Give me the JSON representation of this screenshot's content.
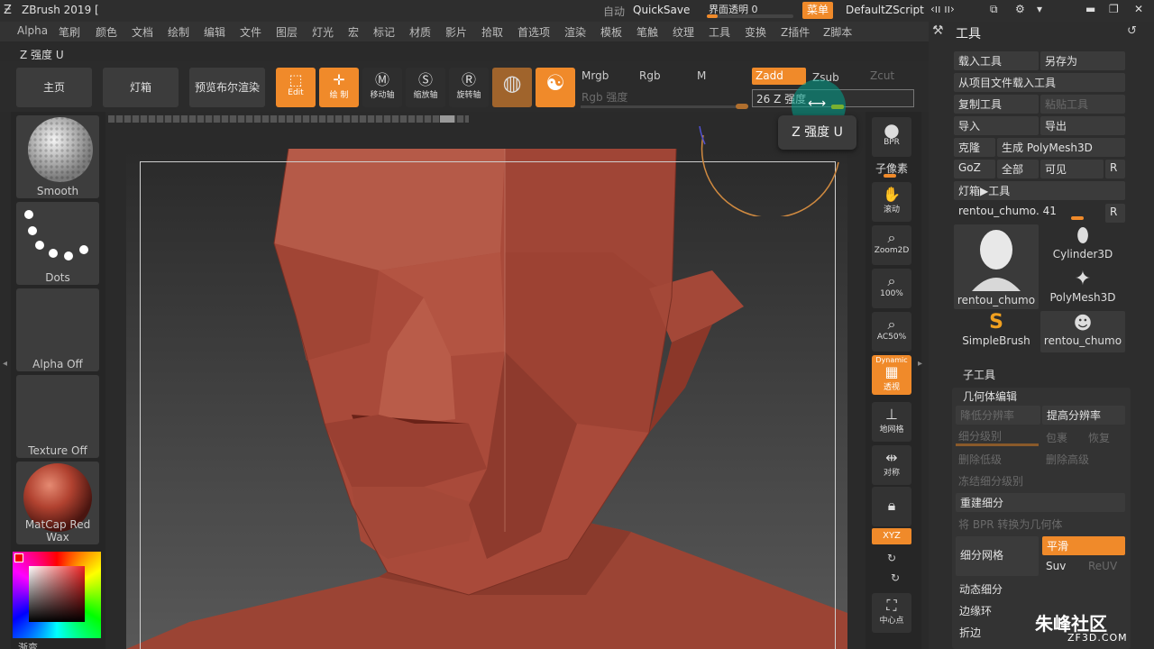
{
  "titlebar": {
    "title": "ZBrush 2019 [",
    "auto_label": "自动",
    "quicksave": "QuickSave",
    "transparency": "界面透明 0",
    "menu": "菜单",
    "script": "DefaultZScript"
  },
  "menubar": {
    "items": [
      "Alpha",
      "笔刷",
      "颜色",
      "文档",
      "绘制",
      "编辑",
      "文件",
      "图层",
      "灯光",
      "宏",
      "标记",
      "材质",
      "影片",
      "拾取",
      "首选项",
      "渲染",
      "模板",
      "笔触",
      "纹理",
      "工具",
      "变换",
      "Z插件",
      "Z脚本"
    ]
  },
  "breadcrumb": {
    "title": "Z 强度  U"
  },
  "shelf": {
    "home": "主页",
    "lightbox": "灯箱",
    "bpr": "预览布尔渲染",
    "edit": "Edit",
    "draw": "绘 制",
    "move": "移动轴",
    "scale": "缩放轴",
    "rotate": "旋转轴",
    "mrgb": "Mrgb",
    "rgb": "Rgb",
    "m": "M",
    "rgb_intensity": "Rgb 强度",
    "zadd": "Zadd",
    "zsub": "Zsub",
    "zcut": "Zcut",
    "zintensity": "26  Z 强度",
    "tooltip": "Z 强度  U"
  },
  "lefttray": {
    "brush": "Smooth",
    "stroke": "Dots",
    "alpha": "Alpha Off",
    "texture": "Texture Off",
    "material": "MatCap Red Wax",
    "gradient": "渐变"
  },
  "righttray": {
    "bpr": "BPR",
    "subpixel": "子像素",
    "scroll": "滚动",
    "zoom2d": "Zoom2D",
    "actual": "100%",
    "ac50": "AC50%",
    "dynamic": "Dynamic",
    "persp": "透视",
    "floor": "地网格",
    "sym": "对称",
    "xyz": "XYZ",
    "center": "中心点"
  },
  "palette": {
    "title": "工具",
    "load": "载入工具",
    "saveas": "另存为",
    "load_project": "从项目文件载入工具",
    "copy": "复制工具",
    "paste": "粘贴工具",
    "import": "导入",
    "export": "导出",
    "clone": "克隆",
    "make_polymesh": "生成 PolyMesh3D",
    "goz": "GoZ",
    "all": "全部",
    "visible": "可见",
    "r": "R",
    "lightbox_tools": "灯箱▶工具",
    "current_tool": "rentou_chumo. 41",
    "thumbs": [
      "rentou_chumo",
      "Cylinder3D",
      "PolyMesh3D",
      "SimpleBrush",
      "rentou_chumo"
    ],
    "subtool": "子工具",
    "geometry": "几何体编辑",
    "lower_res": "降低分辨率",
    "higher_res": "提高分辨率",
    "sdiv": "细分级别",
    "cage": "包裹",
    "restore": "恢复",
    "del_lower": "删除低级",
    "del_higher": "删除高级",
    "freeze": "冻结细分级别",
    "reconstruct": "重建细分",
    "bpr_to_geo": "将 BPR 转换为几何体",
    "divide": "细分网格",
    "smooth": "平滑",
    "suv": "Suv",
    "reuv": "ReUV",
    "dynamic_sub": "动态细分",
    "edgeloop": "边缘环",
    "crease": "折边"
  },
  "watermark": {
    "main": "朱峰社区",
    "sub": "ZF3D.COM"
  },
  "colors": {
    "accent": "#f08a2a",
    "model": "#a94a3a"
  }
}
